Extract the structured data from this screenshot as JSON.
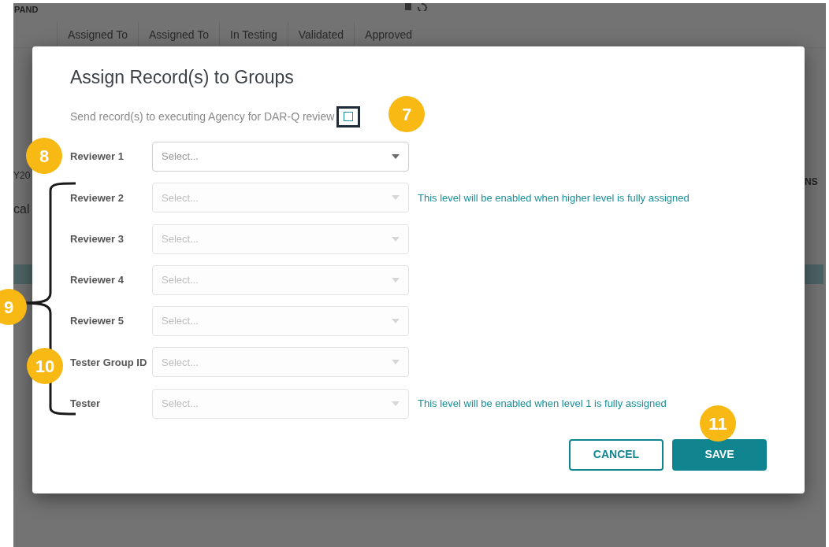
{
  "background": {
    "top_label": "PAND",
    "column_headers": [
      "Assigned To",
      "Assigned To",
      "In Testing",
      "Validated",
      "Approved"
    ],
    "left_texts": [
      "Y20",
      "cal"
    ],
    "right_text": "NS"
  },
  "dialog": {
    "title": "Assign Record(s) to Groups",
    "subtitle": "Send record(s) to executing Agency for DAR-Q review",
    "checkbox": {
      "checked": false
    },
    "rows": [
      {
        "label": "Reviewer 1",
        "placeholder": "Select...",
        "disabled": false
      },
      {
        "label": "Reviewer 2",
        "placeholder": "Select...",
        "disabled": true,
        "hint": "This level will be enabled when higher level is fully assigned"
      },
      {
        "label": "Reviewer 3",
        "placeholder": "Select...",
        "disabled": true
      },
      {
        "label": "Reviewer 4",
        "placeholder": "Select...",
        "disabled": true
      },
      {
        "label": "Reviewer 5",
        "placeholder": "Select...",
        "disabled": true
      },
      {
        "label": "Tester Group ID",
        "placeholder": "Select...",
        "disabled": true
      },
      {
        "label": "Tester",
        "placeholder": "Select...",
        "disabled": true,
        "hint": "This level will be enabled when level 1 is fully assigned"
      }
    ],
    "buttons": [
      {
        "label": "CANCEL",
        "kind": "secondary"
      },
      {
        "label": "SAVE",
        "kind": "primary"
      }
    ]
  },
  "annotations": [
    {
      "label": "7"
    },
    {
      "label": "8"
    },
    {
      "label": "9"
    },
    {
      "label": "10"
    },
    {
      "label": "11"
    }
  ]
}
